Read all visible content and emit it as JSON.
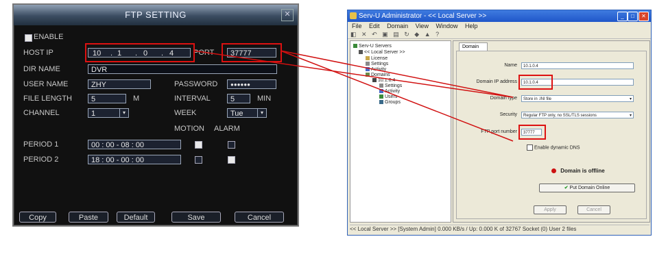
{
  "dvr": {
    "title": "FTP SETTING",
    "enable_label": "ENABLE",
    "host_ip_label": "HOST IP",
    "ip": [
      "10",
      "1",
      "0",
      "4"
    ],
    "port_label": "PORT",
    "port_value": "37777",
    "dir_label": "DIR NAME",
    "dir_value": "DVR",
    "user_label": "USER NAME",
    "user_value": "ZHY",
    "password_label": "PASSWORD",
    "password_value": "●●●●●●",
    "file_length_label": "FILE LENGTH",
    "file_length_value": "5",
    "file_length_unit": "M",
    "interval_label": "INTERVAL",
    "interval_value": "5",
    "interval_unit": "MIN",
    "channel_label": "CHANNEL",
    "channel_value": "1",
    "week_label": "WEEK",
    "week_value": "Tue",
    "motion_label": "MOTION",
    "alarm_label": "ALARM",
    "period1_label": "PERIOD 1",
    "period1_value": "00 : 00    - 08 : 00",
    "period2_label": "PERIOD 2",
    "period2_value": "18 : 00    - 00 : 00",
    "buttons": {
      "copy": "Copy",
      "paste": "Paste",
      "default": "Default",
      "save": "Save",
      "cancel": "Cancel"
    }
  },
  "servu": {
    "title": "Serv-U Administrator - << Local Server >>",
    "menu": [
      "File",
      "Edit",
      "Domain",
      "View",
      "Window",
      "Help"
    ],
    "tree": {
      "root": "Serv-U Servers",
      "server": "<< Local Server >>",
      "items": [
        "License",
        "Settings",
        "Activity",
        "Domains",
        "10.1.0.4",
        "Settings",
        "Activity",
        "Users",
        "Groups"
      ]
    },
    "tab_label": "Domain",
    "name_label": "Name",
    "name_value": "10.1.0.4",
    "ip_label": "Domain IP address",
    "ip_value": "10.1.0.4",
    "type_label": "Domain type",
    "type_value": "Store in .INI file",
    "security_label": "Security",
    "security_value": "Regular FTP only, no SSL/TLS sessions",
    "port_label": "FTP port number",
    "port_value": "37777",
    "dynamic_dns": "Enable dynamic DNS",
    "offline_status": "Domain is offline",
    "put_online": "Put Domain Online",
    "apply": "Apply",
    "cancel": "Cancel",
    "status": "<< Local Server >>     [System Admin] 0.000 KB/s / Up: 0.000 K of 32767 Socket (0) User 2 files"
  },
  "colors": {
    "annotation": "#d11111",
    "dvr_bg": "#111111",
    "status_dot": "#cc1111",
    "online_check": "#2a9a2a"
  }
}
